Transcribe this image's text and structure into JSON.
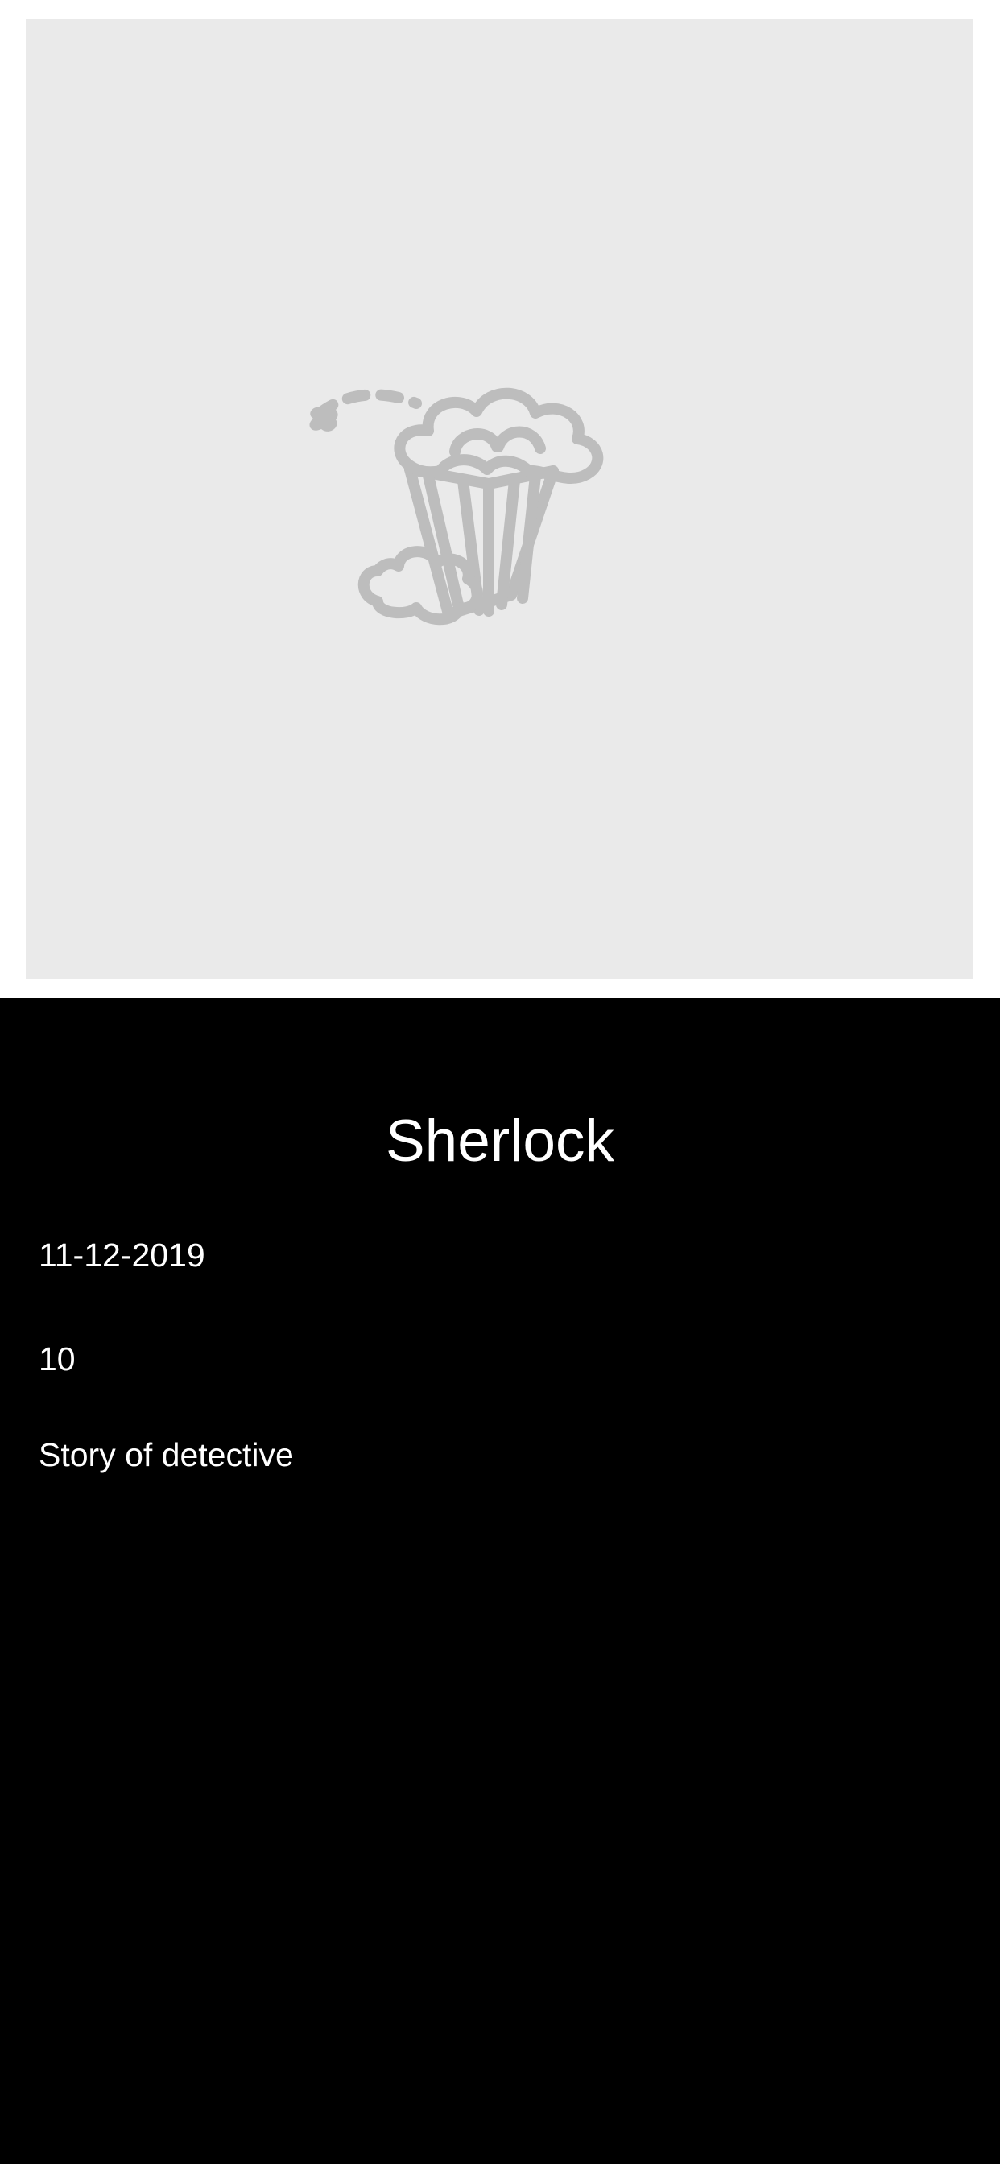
{
  "movie": {
    "poster_icon": "popcorn-icon",
    "title": "Sherlock",
    "release_date": "11-12-2019",
    "rating": "10",
    "overview": "Story of detective"
  },
  "colors": {
    "background": "#000000",
    "poster_placeholder": "#eaeaea",
    "icon": "#bdbdbd",
    "text": "#ffffff"
  }
}
